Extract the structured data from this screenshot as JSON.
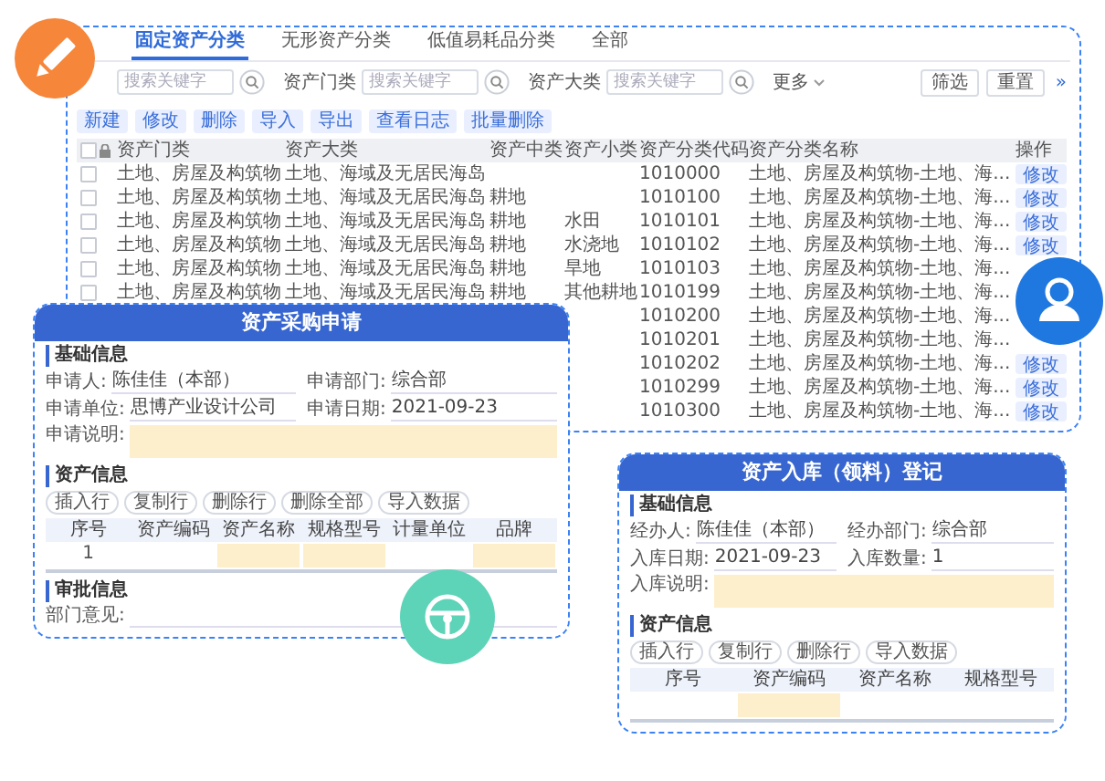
{
  "asset_list": {
    "tabs": [
      {
        "label": "固定资产分类",
        "selected": true
      },
      {
        "label": "无形资产分类",
        "selected": false
      },
      {
        "label": "低值易耗品分类",
        "selected": false
      },
      {
        "label": "全部",
        "selected": false
      }
    ],
    "filters": [
      {
        "placeholder": "搜索关键字"
      },
      {
        "label": "资产门类",
        "placeholder": "搜索关键字"
      },
      {
        "label": "资产大类",
        "placeholder": "搜索关键字"
      }
    ],
    "more": "更多",
    "actions": [
      "筛选",
      "重置"
    ],
    "collapse": "»",
    "toolbar": [
      "新建",
      "修改",
      "删除",
      "导入",
      "导出",
      "查看日志",
      "批量删除"
    ],
    "table": {
      "all_checked": false,
      "columns": [
        "资产门类",
        "资产大类",
        "资产中类",
        "资产小类",
        "资产分类代码",
        "资产分类名称",
        "操作"
      ],
      "rows": [
        {
          "checked": false,
          "cells": [
            "土地、房屋及构筑物",
            "土地、海域及无居民海岛",
            null,
            null,
            "1010000",
            "土地、房屋及构筑物-土地、海..."
          ],
          "action": "修改"
        },
        {
          "checked": false,
          "cells": [
            "土地、房屋及构筑物",
            "土地、海域及无居民海岛",
            "耕地",
            null,
            "1010100",
            "土地、房屋及构筑物-土地、海..."
          ],
          "action": "修改"
        },
        {
          "checked": false,
          "cells": [
            "土地、房屋及构筑物",
            "土地、海域及无居民海岛",
            "耕地",
            "水田",
            "1010101",
            "土地、房屋及构筑物-土地、海..."
          ],
          "action": "修改"
        },
        {
          "checked": false,
          "cells": [
            "土地、房屋及构筑物",
            "土地、海域及无居民海岛",
            "耕地",
            "水浇地",
            "1010102",
            "土地、房屋及构筑物-土地、海..."
          ],
          "action": "修改"
        },
        {
          "checked": false,
          "cells": [
            "土地、房屋及构筑物",
            "土地、海域及无居民海岛",
            "耕地",
            "旱地",
            "1010103",
            "土地、房屋及构筑物-土地、海..."
          ]
        },
        {
          "checked": false,
          "cells": [
            "土地、房屋及构筑物",
            "土地、海域及无居民海岛",
            "耕地",
            "其他耕地",
            "1010199",
            "土地、房屋及构筑物-土地、海..."
          ]
        },
        {
          "cells": [
            null,
            null,
            null,
            null,
            "1010200",
            "土地、房屋及构筑物-土地、海..."
          ]
        },
        {
          "cells": [
            null,
            null,
            null,
            null,
            "1010201",
            "土地、房屋及构筑物-土地、海..."
          ]
        },
        {
          "cells": [
            null,
            null,
            null,
            null,
            "1010202",
            "土地、房屋及构筑物-土地、海..."
          ],
          "action": "修改"
        },
        {
          "cells": [
            null,
            null,
            null,
            null,
            "1010299",
            "土地、房屋及构筑物-土地、海..."
          ],
          "action": "修改"
        },
        {
          "cells": [
            null,
            null,
            null,
            null,
            "1010300",
            "土地、房屋及构筑物-土地、海..."
          ],
          "action": "修改"
        }
      ]
    }
  },
  "purchase_form": {
    "title": "资产采购申请",
    "sections": [
      {
        "kind": "heading",
        "text": "基础信息"
      },
      {
        "kind": "fields",
        "items": [
          {
            "label": "申请人:",
            "value": "陈佳佳（本部）"
          },
          {
            "label": "申请部门:",
            "value": "综合部"
          },
          {
            "label": "申请单位:",
            "value": "思博产业设计公司"
          },
          {
            "label": "申请日期:",
            "value": "2021-09-23"
          }
        ]
      },
      {
        "kind": "textarea",
        "label": "申请说明:"
      },
      {
        "kind": "heading",
        "text": "资产信息"
      },
      {
        "kind": "buttons",
        "items": [
          "插入行",
          "复制行",
          "删除行",
          "删除全部",
          "导入数据"
        ]
      },
      {
        "kind": "table",
        "columns": [
          "序号",
          "资产编码",
          "资产名称",
          "规格型号",
          "计量单位",
          "品牌"
        ],
        "rows": [
          [
            {
              "text": "1",
              "required": false
            },
            {
              "required": false
            },
            {
              "required": true
            },
            {
              "required": true
            },
            {
              "required": false
            },
            {
              "required": true
            }
          ]
        ]
      },
      {
        "kind": "heading",
        "text": "审批信息"
      },
      {
        "kind": "line",
        "label": "部门意见:"
      }
    ]
  },
  "inbound_form": {
    "title": "资产入库（领料）登记",
    "sections": [
      {
        "kind": "heading",
        "text": "基础信息"
      },
      {
        "kind": "fields",
        "items": [
          {
            "label": "经办人:",
            "value": "陈佳佳（本部）"
          },
          {
            "label": "经办部门:",
            "value": "综合部"
          },
          {
            "label": "入库日期:",
            "value": "2021-09-23"
          },
          {
            "label": "入库数量:",
            "value": "1"
          }
        ]
      },
      {
        "kind": "textarea",
        "label": "入库说明:"
      },
      {
        "kind": "heading",
        "text": "资产信息"
      },
      {
        "kind": "buttons",
        "items": [
          "插入行",
          "复制行",
          "删除行",
          "导入数据"
        ]
      },
      {
        "kind": "table",
        "columns": [
          "序号",
          "资产编码",
          "资产名称",
          "规格型号"
        ],
        "rows": [
          [
            {
              "required": false
            },
            {
              "required": true
            },
            {
              "required": false
            },
            {
              "required": false
            }
          ]
        ]
      }
    ]
  }
}
